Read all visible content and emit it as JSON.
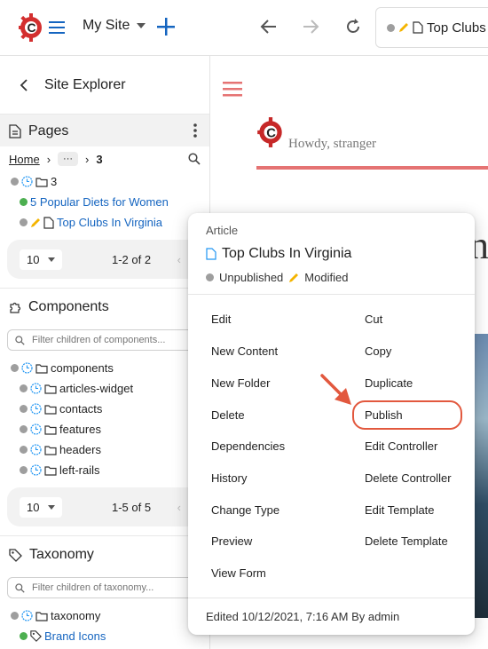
{
  "topbar": {
    "site_label": "My Site",
    "address_title": "Top Clubs"
  },
  "sidebar": {
    "title": "Site Explorer",
    "pages": {
      "title": "Pages",
      "crumb_home": "Home",
      "crumb_ellipsis": "···",
      "crumb_current": "3",
      "folder": "3",
      "items": [
        "5 Popular Diets for Women",
        "Top Clubs In Virginia"
      ],
      "page_size": "10",
      "range": "1-2 of 2"
    },
    "components": {
      "title": "Components",
      "filter_placeholder": "Filter children of components...",
      "root": "components",
      "items": [
        "articles-widget",
        "contacts",
        "features",
        "headers",
        "left-rails"
      ],
      "page_size": "10",
      "range": "1-5 of 5"
    },
    "taxonomy": {
      "title": "Taxonomy",
      "filter_placeholder": "Filter children of taxonomy...",
      "root": "taxonomy",
      "items": [
        "Brand Icons"
      ]
    }
  },
  "preview": {
    "greeting": "Howdy, stranger",
    "big_letter": "n"
  },
  "menu": {
    "type": "Article",
    "title": "Top Clubs In Virginia",
    "status_unpublished": "Unpublished",
    "status_modified": "Modified",
    "left": [
      "Edit",
      "New Content",
      "New Folder",
      "Delete",
      "Dependencies",
      "History",
      "Change Type",
      "Preview",
      "View Form"
    ],
    "right": [
      "Cut",
      "Copy",
      "Duplicate",
      "Publish",
      "Edit Controller",
      "Delete Controller",
      "Edit Template",
      "Delete Template"
    ],
    "footer": "Edited 10/12/2021, 7:16 AM By admin"
  },
  "colors": {
    "brand_red": "#d32f2f",
    "accent_blue": "#1565c0",
    "highlight": "#e2583e"
  }
}
